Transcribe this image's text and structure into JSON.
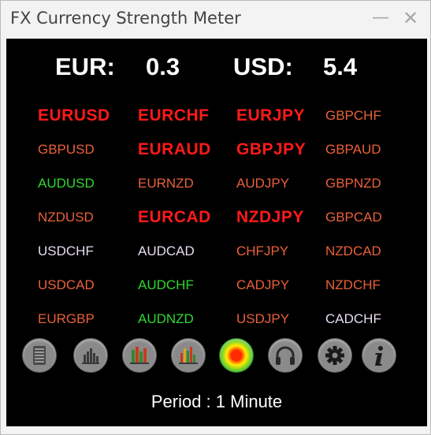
{
  "window": {
    "title": "FX Currency Strength Meter",
    "minimize_glyph": "—",
    "close_glyph": "✕"
  },
  "header": {
    "base_label": "EUR:",
    "base_value": "0.3",
    "quote_label": "USD:",
    "quote_value": "5.4"
  },
  "colors": {
    "strong_red": "#ff1a1a",
    "weak_red": "#e8603a",
    "green": "#2ed82e",
    "white": "#e6e6e6",
    "lavender": "#e6dcf2"
  },
  "pairs": [
    [
      "EURUSD",
      "EURCHF",
      "EURJPY",
      "GBPCHF"
    ],
    [
      "GBPUSD",
      "EURAUD",
      "GBPJPY",
      "GBPAUD"
    ],
    [
      "AUDUSD",
      "EURNZD",
      "AUDJPY",
      "GBPNZD"
    ],
    [
      "NZDUSD",
      "EURCAD",
      "NZDJPY",
      "GBPCAD"
    ],
    [
      "USDCHF",
      "AUDCAD",
      "CHFJPY",
      "NZDCAD"
    ],
    [
      "USDCAD",
      "AUDCHF",
      "CADJPY",
      "NZDCHF"
    ],
    [
      "EURGBP",
      "AUDNZD",
      "USDJPY",
      "CADCHF"
    ]
  ],
  "pair_styles": [
    [
      "strong",
      "strong",
      "strong",
      "weak"
    ],
    [
      "weak",
      "strong",
      "strong",
      "weak"
    ],
    [
      "green",
      "weak",
      "weak",
      "weak"
    ],
    [
      "weak",
      "strong",
      "strong",
      "weak"
    ],
    [
      "lavender",
      "lavender",
      "weak",
      "weak"
    ],
    [
      "weak",
      "green",
      "weak",
      "weak"
    ],
    [
      "weak",
      "green",
      "weak",
      "lavender"
    ]
  ],
  "toolbar": [
    {
      "name": "list-icon"
    },
    {
      "name": "bar-chart-icon"
    },
    {
      "name": "multi-bar-chart-icon"
    },
    {
      "name": "colored-bar-chart-icon"
    },
    {
      "name": "heatmap-icon",
      "active": true
    },
    {
      "name": "headphones-icon"
    },
    {
      "name": "gear-icon"
    },
    {
      "name": "info-icon"
    }
  ],
  "footer": {
    "period_text": "Period : 1 Minute"
  }
}
